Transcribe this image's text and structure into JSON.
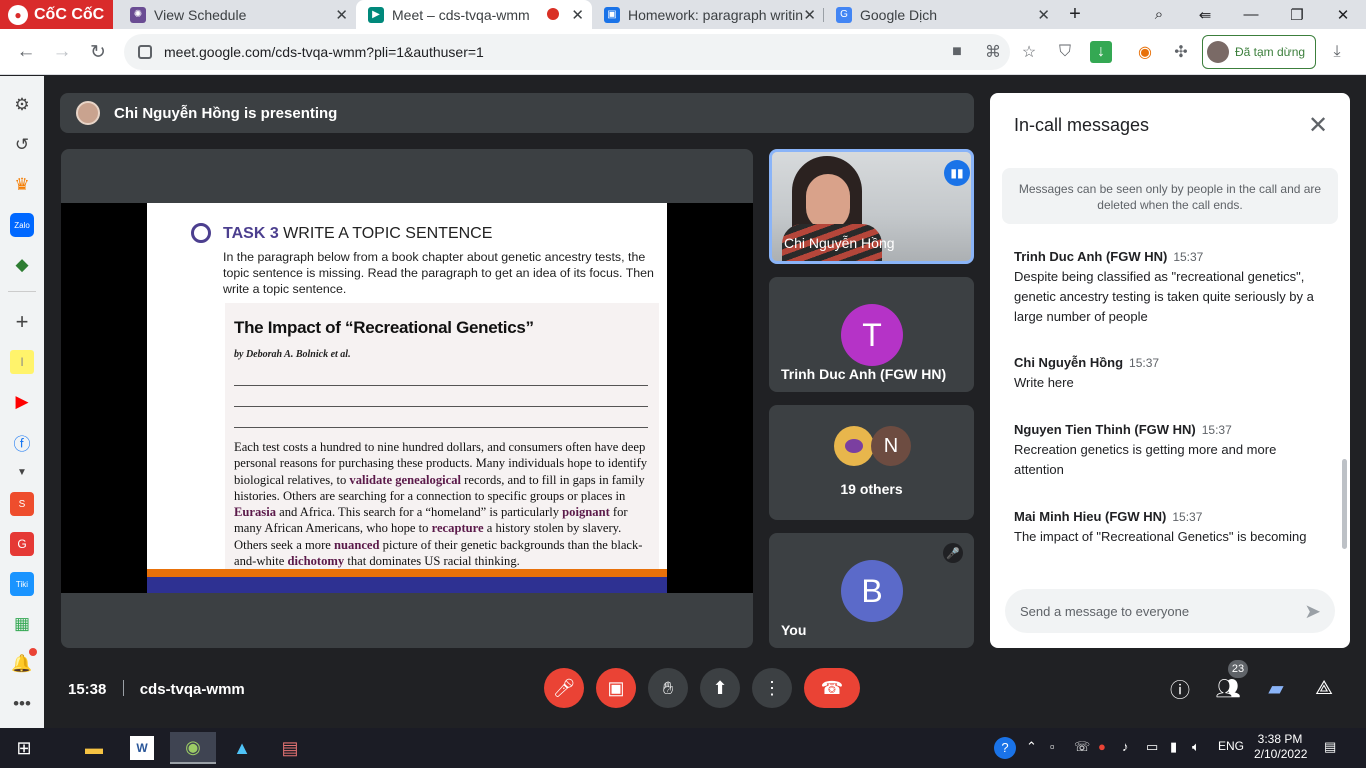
{
  "browser": {
    "brand": "CốC CốC",
    "tabs": [
      {
        "title": "View Schedule",
        "color": "#6a4c93"
      },
      {
        "title": "Meet – cds-tvqa-wmm",
        "color": "#00897b"
      },
      {
        "title": "Homework: paragraph writin",
        "color": "#1a73e8"
      },
      {
        "title": "Google Dịch",
        "color": "#4285f4"
      }
    ],
    "url": "meet.google.com/cds-tvqa-wmm?pli=1&authuser=1",
    "paused_label": "Đã tạm dừng"
  },
  "meet": {
    "presenting_text": "Chi Nguyễn Hồng is presenting",
    "meeting_code": "cds-tvqa-wmm",
    "time": "15:38",
    "participants_count": "23"
  },
  "slide": {
    "task_label": "TASK 3",
    "task_title": "WRITE A TOPIC SENTENCE",
    "instructions": "In the paragraph below from a book chapter about genetic ancestry tests, the topic sentence is missing. Read the paragraph to get an idea of its focus. Then write a topic sentence.",
    "article_title": "The Impact of “Recreational Genetics”",
    "byline": "by Deborah A. Bolnick et al.",
    "body": [
      {
        "t": "Each test costs a hundred to nine hundred dollars, and consumers often have deep personal reasons for purchasing these products. Many individuals hope to identify biological relatives, to "
      },
      {
        "t": "validate genealogical",
        "b": true
      },
      {
        "t": " records, and to fill in gaps in family histories. Others are searching for a connection to specific groups or places in "
      },
      {
        "t": "Eurasia",
        "b": true
      },
      {
        "t": " and Africa. This search for a “homeland” is particularly "
      },
      {
        "t": "poignant",
        "b": true
      },
      {
        "t": " for many African Americans, who hope to "
      },
      {
        "t": "recapture",
        "b": true
      },
      {
        "t": " a history stolen by slavery. Others seek a more "
      },
      {
        "t": "nuanced",
        "b": true
      },
      {
        "t": " picture of their genetic backgrounds than the black-and-white "
      },
      {
        "t": "dichotomy",
        "b": true
      },
      {
        "t": " that dominates US racial thinking."
      }
    ]
  },
  "tiles": {
    "presenter_name": "Chi Nguyễn Hồng",
    "trinh_initial": "T",
    "trinh_name": "Trinh Duc Anh (FGW HN)",
    "others_initial": "N",
    "others_label": "19 others",
    "you_initial": "B",
    "you_label": "You"
  },
  "chat": {
    "title": "In-call messages",
    "notice": "Messages can be seen only by people in the call and are deleted when the call ends.",
    "messages": [
      {
        "sender": "Trinh Duc Anh (FGW HN)",
        "time": "15:37",
        "text": "Despite being classified as \"recreational genetics\", genetic ancestry testing is taken quite seriously by a large number of people"
      },
      {
        "sender": "Chi Nguyễn Hồng",
        "time": "15:37",
        "text": "Write here"
      },
      {
        "sender": "Nguyen Tien Thinh (FGW HN)",
        "time": "15:37",
        "text": "Recreation genetics is getting more and more attention"
      },
      {
        "sender": "Mai Minh Hieu (FGW HN)",
        "time": "15:37",
        "text": "The impact of \"Recreational Genetics\" is becoming"
      }
    ],
    "placeholder": "Send a message to everyone"
  },
  "taskbar": {
    "lang": "ENG",
    "time": "3:38 PM",
    "date": "2/10/2022"
  },
  "colors": {
    "meet_bg": "#202124",
    "tile_bg": "#3c4043",
    "end_call": "#ea4335",
    "trinh_avatar": "#b533c7",
    "you_avatar": "#5b6ac9",
    "others_avatar": "#6d4c41",
    "active_speaker": "#8ab4f8"
  }
}
